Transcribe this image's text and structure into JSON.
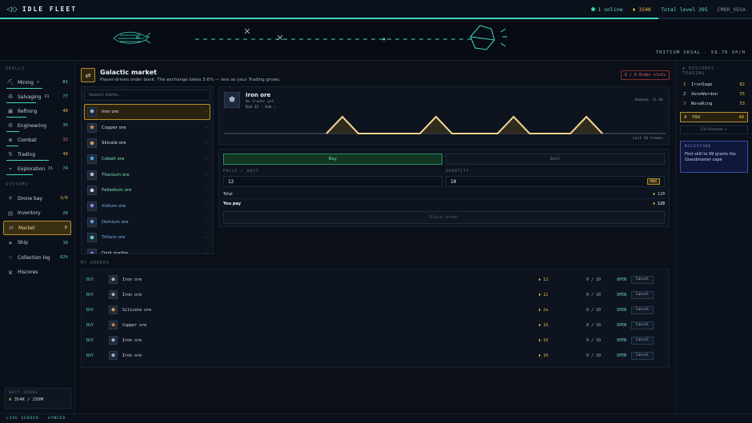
{
  "app": {
    "title": "IDLE FLEET",
    "logo_icon": "◁◇"
  },
  "topbar": {
    "online": "1 online",
    "credits": "354K",
    "total_level": "Total level 395",
    "username": "CMDR_VEGA"
  },
  "xp_progress": 0.876,
  "hero": {
    "harvest_text": "TRITIUM SKSAL · 58.7K XP/H"
  },
  "sidebar": {
    "skills_label": "SKILLS",
    "skills": [
      {
        "icon": "⛏",
        "label": "Mining",
        "boost": "+",
        "level": "81",
        "level_color": "#5ed6c6",
        "progress": 0.55
      },
      {
        "icon": "♻",
        "label": "Salvaging",
        "boost": "X1",
        "level": "77",
        "level_color": "#5ed6c6",
        "progress": 0.45
      },
      {
        "icon": "▣",
        "label": "Refining",
        "boost": "",
        "level": "48",
        "level_color": "#e8b84b",
        "progress": 0.3
      },
      {
        "icon": "⚙",
        "label": "Engineering",
        "boost": "",
        "level": "35",
        "level_color": "#5ed6c6",
        "progress": 0.2
      },
      {
        "icon": "◈",
        "label": "Combat",
        "boost": "",
        "level": "32",
        "level_color": "#e07070",
        "progress": 0.18
      },
      {
        "icon": "⇅",
        "label": "Trading",
        "boost": "",
        "level": "48",
        "level_color": "#e8b84b",
        "progress": 0.65
      },
      {
        "icon": "⌖",
        "label": "Exploration",
        "boost": "X1",
        "level": "74",
        "level_color": "#5ed6c6",
        "progress": 0.4
      }
    ],
    "systems_label": "SYSTEMS",
    "systems": [
      {
        "icon": "✕",
        "label": "Drone bay",
        "count": "3/6",
        "count_color": "#e8b84b",
        "active": false
      },
      {
        "icon": "▤",
        "label": "Inventory",
        "count": "26",
        "count_color": "#5ed6c6",
        "active": false
      },
      {
        "icon": "⇄",
        "label": "Market",
        "count": "6",
        "count_color": "#f1d58e",
        "active": true
      },
      {
        "icon": "➤",
        "label": "Ship",
        "count": "19",
        "count_color": "#5ed6c6",
        "active": false
      },
      {
        "icon": "☆",
        "label": "Collection log",
        "count": "62%",
        "count_color": "#5ed6c6",
        "active": false
      },
      {
        "icon": "♛",
        "label": "Hiscores",
        "count": "",
        "count_color": "#5ed6c6",
        "active": false
      }
    ],
    "next_drone_label": "NEXT DRONE",
    "next_drone_value": "354K / 250M"
  },
  "market": {
    "title": "Galactic market",
    "subtitle": "Player-driven order book. The exchange takes 3.6% — less as your Trading grows.",
    "slots": "6 / 6 Order slots",
    "search_placeholder": "Search items...",
    "items": [
      {
        "name": "Iron ore",
        "color": "#d6dfea",
        "icon_color": "#9fb0c4",
        "selected": true
      },
      {
        "name": "Copper ore",
        "color": "#d6dfea",
        "icon_color": "#d07a3c",
        "selected": false
      },
      {
        "name": "Silicate ore",
        "color": "#d6dfea",
        "icon_color": "#c9a050",
        "selected": false
      },
      {
        "name": "Cobalt ore",
        "color": "#7fe0b0",
        "icon_color": "#4fa0e0",
        "selected": false
      },
      {
        "name": "Titanium ore",
        "color": "#7fe0b0",
        "icon_color": "#b0c0d0",
        "selected": false
      },
      {
        "name": "Palladium ore",
        "color": "#7fe0b0",
        "icon_color": "#d0d8e0",
        "selected": false
      },
      {
        "name": "Iridium ore",
        "color": "#7fb0f0",
        "icon_color": "#9080e0",
        "selected": false
      },
      {
        "name": "Osmium ore",
        "color": "#7fb0f0",
        "icon_color": "#60a0d0",
        "selected": false
      },
      {
        "name": "Tritium ore",
        "color": "#7fb0f0",
        "icon_color": "#60d0c0",
        "selected": false
      },
      {
        "name": "Dark matter",
        "color": "#d6dfea",
        "icon_color": "#a070e0",
        "selected": false
      }
    ],
    "selected_item": {
      "name": "Iron ore",
      "sub1": "No trades yet",
      "sub2": "Bid 12 · Ask –",
      "demand": "Demand: 21.6k",
      "trades_caption": "Last 50 trades"
    },
    "order_form": {
      "buy_tab": "Buy",
      "sell_tab": "Sell",
      "price_label": "PRICE / UNIT",
      "price_value": "12",
      "quantity_label": "QUANTITY",
      "quantity_value": "10",
      "max_label": "MAX",
      "total_label": "Total",
      "total_value": "120",
      "you_pay_label": "You pay",
      "you_pay_value": "120",
      "place_order": "Place order"
    },
    "my_orders_label": "MY ORDERS",
    "orders": [
      {
        "side": "BUY",
        "name": "Iron ore",
        "icon_color": "#9fb0c4",
        "price": "12",
        "fill": "0 / 10",
        "status": "OPEN",
        "cancel": "Cancel"
      },
      {
        "side": "BUY",
        "name": "Iron ore",
        "icon_color": "#9fb0c4",
        "price": "12",
        "fill": "0 / 10",
        "status": "OPEN",
        "cancel": "Cancel"
      },
      {
        "side": "BUY",
        "name": "Silicate ore",
        "icon_color": "#c9a050",
        "price": "2a",
        "fill": "0 / 10",
        "status": "OPEN",
        "cancel": "Cancel"
      },
      {
        "side": "BUY",
        "name": "Copper ore",
        "icon_color": "#d07a3c",
        "price": "18",
        "fill": "0 / 10",
        "status": "OPEN",
        "cancel": "Cancel"
      },
      {
        "side": "BUY",
        "name": "Iron ore",
        "icon_color": "#9fb0c4",
        "price": "10",
        "fill": "0 / 10",
        "status": "OPEN",
        "cancel": "Cancel"
      },
      {
        "side": "BUY",
        "name": "Iron ore",
        "icon_color": "#9fb0c4",
        "price": "10",
        "fill": "0 / 10",
        "status": "OPEN",
        "cancel": "Cancel"
      }
    ]
  },
  "hiscores": {
    "label": "HISCORES · TRADING",
    "rows": [
      {
        "rank": "1",
        "name": "IronSage",
        "score": "82"
      },
      {
        "rank": "2",
        "name": "XenoWarden",
        "score": "55"
      },
      {
        "rank": "3",
        "name": "NovaKing",
        "score": "53"
      }
    ],
    "you": {
      "rank": "4",
      "name": "YOU",
      "score": "48"
    },
    "full_label": "Full hiscores →"
  },
  "milestone": {
    "label": "MILESTONE",
    "text": "First skill to 99 grants the Grandmaster cape"
  },
  "footer": {
    "status": "LIVE SERVER · SYNCED"
  },
  "colors": {
    "accent": "#5ed6c6",
    "gold": "#e8b84b",
    "chart_line": "#f1d58e"
  }
}
